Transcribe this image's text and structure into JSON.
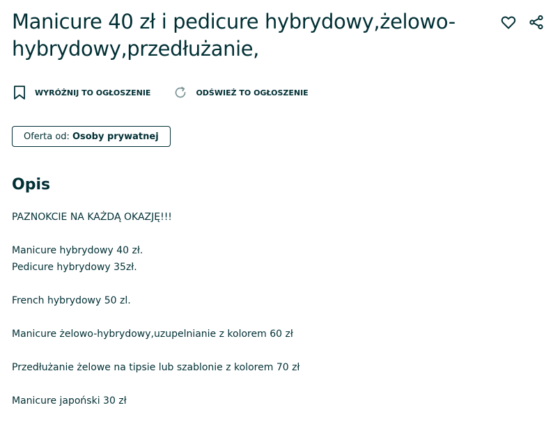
{
  "listing": {
    "title": "Manicure 40 zł i pedicure hybrydowy,żelowo-hybrydowy,przedłużanie,",
    "actions": {
      "favorite_icon": "heart-outline-icon",
      "share_icon": "share-icon"
    }
  },
  "promo": {
    "highlight_label": "WYRÓŻNIJ TO OGŁOSZENIE",
    "highlight_icon": "bookmark-icon",
    "refresh_label": "ODŚWIEŻ TO OGŁOSZENIE",
    "refresh_icon": "refresh-icon"
  },
  "offer": {
    "label": "Oferta od:",
    "value": "Osoby prywatnej"
  },
  "description": {
    "heading": "Opis",
    "lines": [
      "PAZNOKCIE NA KAŻDĄ OKAZJĘ!!!",
      "",
      "Manicure hybrydowy 40 zł.",
      "Pedicure hybrydowy 35zł.",
      "",
      "French hybrydowy 50 zl.",
      "",
      "Manicure żelowo-hybrydowy,uzupelnianie z kolorem 60 zł",
      "",
      "Przedłużanie żelowe na tipsie lub szablonie z kolorem 70 zł",
      "",
      "Manicure japoński 30 zł"
    ]
  },
  "colors": {
    "text": "#002f34",
    "icon_muted": "#7f9799",
    "background": "#ffffff"
  }
}
